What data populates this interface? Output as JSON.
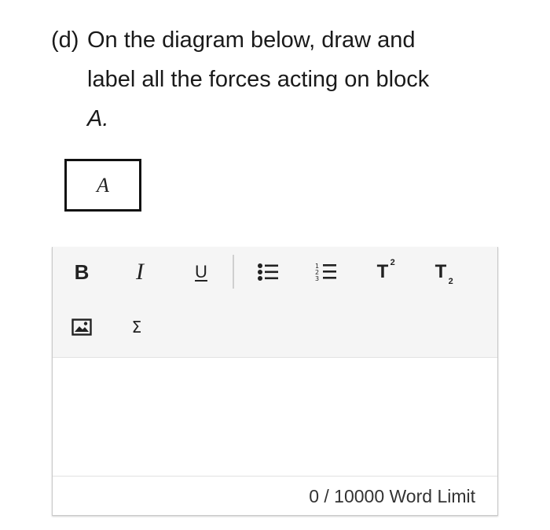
{
  "question": {
    "label": "(d)",
    "line1": "On the diagram below, draw and",
    "line2": "label all the forces acting on block",
    "line3": "A."
  },
  "diagram": {
    "block_label": "A"
  },
  "editor": {
    "toolbar": {
      "bold_label": "B",
      "italic_label": "I",
      "underline_label": "U",
      "superscript_base": "T",
      "superscript_mark": "2",
      "subscript_base": "T",
      "subscript_mark": "2",
      "equation_label": "Σ"
    },
    "content": "",
    "word_count": "0 / 10000 Word Limit"
  }
}
